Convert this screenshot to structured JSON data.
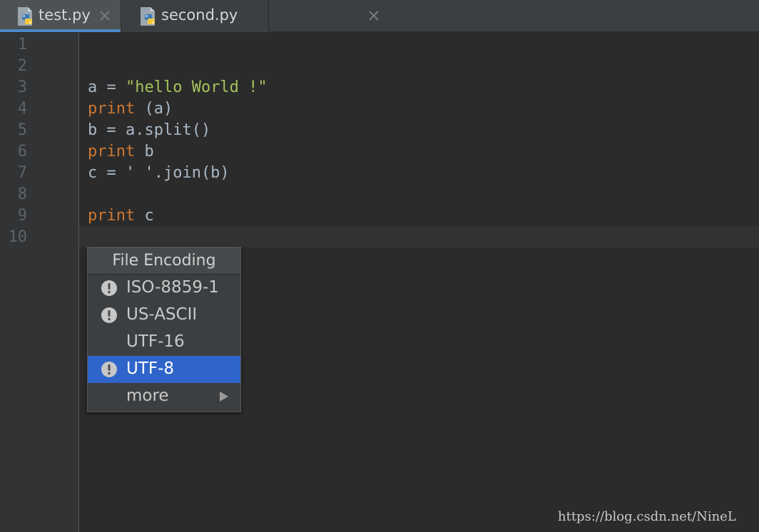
{
  "tabs": [
    {
      "label": "test.py",
      "active": true,
      "icon": "python-file-icon"
    },
    {
      "label": "second.py",
      "active": false,
      "icon": "python-file-icon"
    }
  ],
  "editor": {
    "line_numbers": [
      "1",
      "2",
      "3",
      "4",
      "5",
      "6",
      "7",
      "8",
      "9",
      "10"
    ],
    "current_line": 10,
    "lines": {
      "l3": {
        "name": "a = ",
        "str": "\"hello World !\""
      },
      "l4": {
        "kw": "print",
        "rest": " (a)"
      },
      "l5": {
        "text": "b = a.split()"
      },
      "l6": {
        "kw": "print",
        "rest": " b"
      },
      "l7": {
        "text": "c = ' '.join(b)"
      },
      "l9": {
        "kw": "print",
        "rest": " c"
      }
    }
  },
  "popup": {
    "title": "File Encoding",
    "items": [
      {
        "label": "ISO-8859-1",
        "icon": "warning-icon",
        "selected": false
      },
      {
        "label": "US-ASCII",
        "icon": "warning-icon",
        "selected": false
      },
      {
        "label": "UTF-16",
        "icon": null,
        "selected": false
      },
      {
        "label": "UTF-8",
        "icon": "warning-icon",
        "selected": true
      },
      {
        "label": "more",
        "icon": "submenu-arrow-icon",
        "selected": false
      }
    ]
  },
  "watermark": "https://blog.csdn.net/NineL",
  "colors": {
    "keyword": "#cc7832",
    "string": "#a5c25c",
    "text": "#a9b7c6",
    "selection": "#2f65ca",
    "tab_active_underline": "#4a88c7"
  }
}
